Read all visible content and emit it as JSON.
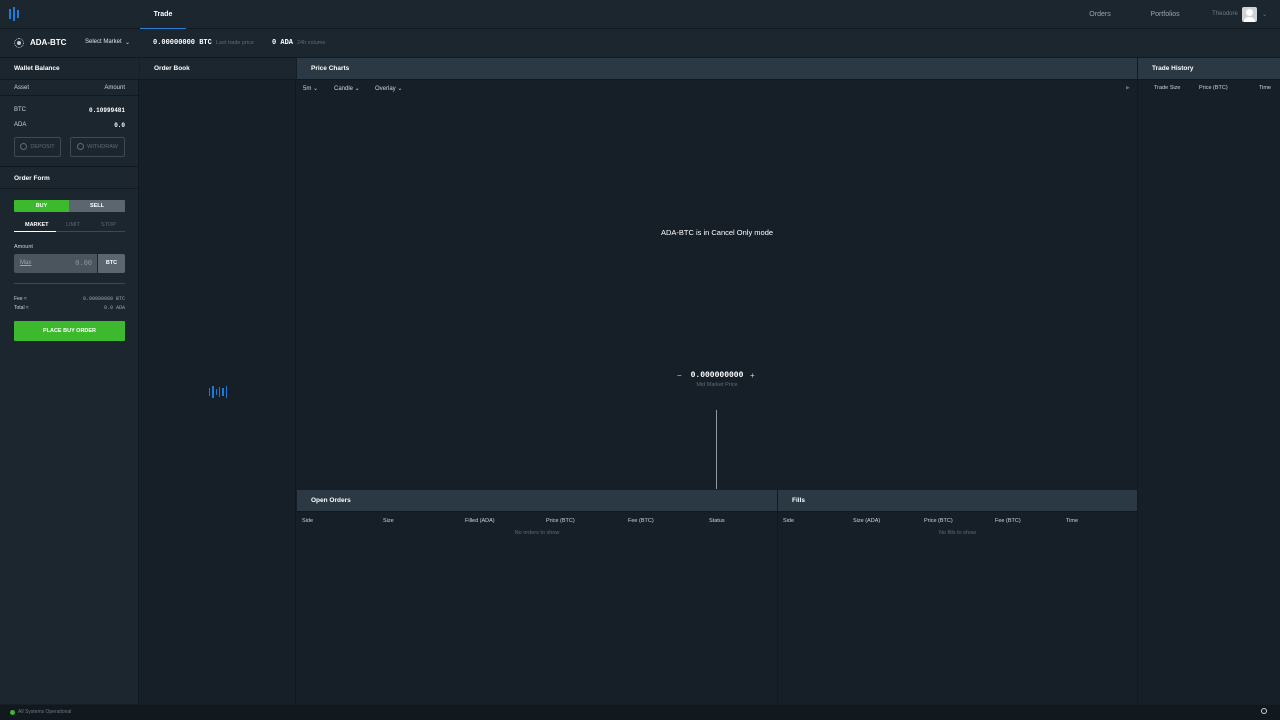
{
  "nav": {
    "trade": "Trade",
    "orders": "Orders",
    "portfolios": "Portfolios",
    "user": "Theodore",
    "logo_icon": "bars-logo-icon",
    "avatar_icon": "user-avatar-icon",
    "user_chevron": "⌄"
  },
  "ticker": {
    "market": "ADA-BTC",
    "select_market": "Select Market",
    "select_chevron": "⌄",
    "last_price": "0.00000000 BTC",
    "last_price_label": "Last trade price",
    "volume": "0 ADA",
    "volume_label": "24h volume"
  },
  "wallet": {
    "title": "Wallet Balance",
    "col_asset": "Asset",
    "col_amount": "Amount",
    "rows": [
      {
        "asset": "BTC",
        "amount": "0.10999481"
      },
      {
        "asset": "ADA",
        "amount": "0.0"
      }
    ],
    "deposit": "DEPOSIT",
    "withdraw": "WITHDRAW"
  },
  "order_form": {
    "title": "Order Form",
    "buy": "BUY",
    "sell": "SELL",
    "types": [
      "MARKET",
      "LIMIT",
      "STOP"
    ],
    "amount_label": "Amount",
    "max": "Max",
    "amount_value": "0.00",
    "currency": "BTC",
    "fee_label": "Fee ≈",
    "fee_value": "0.00000000 BTC",
    "total_label": "Total ≈",
    "total_value": "0.0 ADA",
    "place": "PLACE BUY ORDER"
  },
  "order_book": {
    "title": "Order Book"
  },
  "price_charts": {
    "title": "Price Charts",
    "interval": "5m ⌄",
    "chart_type": "Candle ⌄",
    "overlay": "Overlay ⌄",
    "play_icon": "▶",
    "cancel_message": "ADA-BTC is in Cancel Only mode",
    "mid_price": "0.000000000",
    "mid_label": "Mid Market Price",
    "minus": "−",
    "plus": "+"
  },
  "trade_history": {
    "title": "Trade History",
    "cols": [
      "Trade Size",
      "Price (BTC)",
      "Time"
    ]
  },
  "open_orders": {
    "title": "Open Orders",
    "cols": [
      "Side",
      "Size",
      "Filled (ADA)",
      "Price (BTC)",
      "Fee (BTC)",
      "Status"
    ],
    "empty": "No orders to show"
  },
  "fills": {
    "title": "Fills",
    "cols": [
      "Side",
      "Size (ADA)",
      "Price (BTC)",
      "Fee (BTC)",
      "Time"
    ],
    "empty": "No fills to show"
  },
  "status": {
    "text": "All Systems Operational"
  },
  "colors": {
    "accent_blue": "#1f7bd9",
    "buy_green": "#3db92e",
    "panel_header": "#2a3943"
  }
}
